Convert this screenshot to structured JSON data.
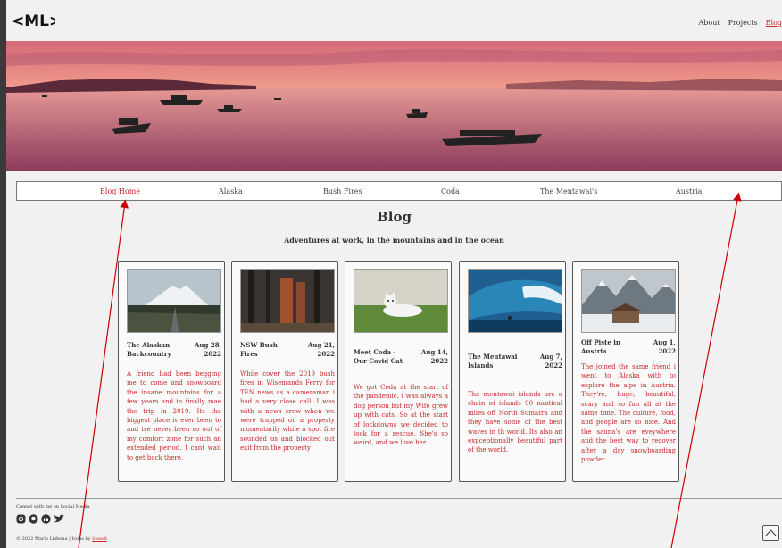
{
  "brand": {
    "logo_text": "<ML>"
  },
  "nav": {
    "about": "About",
    "projects": "Projects",
    "blog": "Blog"
  },
  "tabs": [
    {
      "label": "Blog Home",
      "active": true
    },
    {
      "label": "Alaska",
      "active": false
    },
    {
      "label": "Bush Fires",
      "active": false
    },
    {
      "label": "Coda",
      "active": false
    },
    {
      "label": "The Mentawai's",
      "active": false
    },
    {
      "label": "Austria",
      "active": false
    }
  ],
  "main": {
    "title": "Blog",
    "subtitle": "Adventures at work, in the mountains and in the ocean"
  },
  "posts": [
    {
      "title": "The Alaskan Backcountry",
      "date": "Aug 28, 2022",
      "text": "A friend had been begging me to come and snowboard the insane mountains for a few years and in finally mae the trip in 2019. Its the biggest place iv ever been to and ive never been so out of my comfort zone for such an extended period. I cant wait to get back there."
    },
    {
      "title": "NSW Bush Fires",
      "date": "Aug 21, 2022",
      "text": "While cover the 2019 bush fires in Wisemands Ferry for TEN news as a cameraman i had a very close call. I was with a news crew when we were trapped on a property momentarily while a spot fire sounded us and blocked out exit from the property"
    },
    {
      "title": "Meet Coda - Our Covid Cat",
      "date": "Aug 14, 2022",
      "text": "We got Coda at the start of the pandemic. I was always a dog person but my Wife grew up with cats. So at the start of lockdowns we decided to look for a rescue. She's so weird, and we love her"
    },
    {
      "title": "The Mentawai Islands",
      "date": "Aug 7, 2022",
      "text": "The mentawai islands are a chain of islands 90 nautical miles off North Sumatra and they have some of the best waves in th world. Its also an expceptionally beautiful part of the world."
    },
    {
      "title": "Off Piste in Austria",
      "date": "Aug 1, 2022",
      "text": "The joined the same friend i went to Alaska with to explore the alps in Austria. They're, huge, beautiful, scary and so fun all at the same time. The culture, food, and people are so nice. And the sauna's are eveywhere and the best way to recover after a day snowboarding powder."
    }
  ],
  "footer": {
    "connect": "Connet with me on Social Media",
    "copyright": "© 2022 Mario Lisbona | Icons by ",
    "icons_link": "Icons8"
  },
  "icons": [
    "instagram-icon",
    "github-icon",
    "linkedin-icon",
    "twitter-icon",
    "back-to-top-icon"
  ],
  "colors": {
    "accent": "#c62828",
    "annotation": "#cc0000"
  }
}
